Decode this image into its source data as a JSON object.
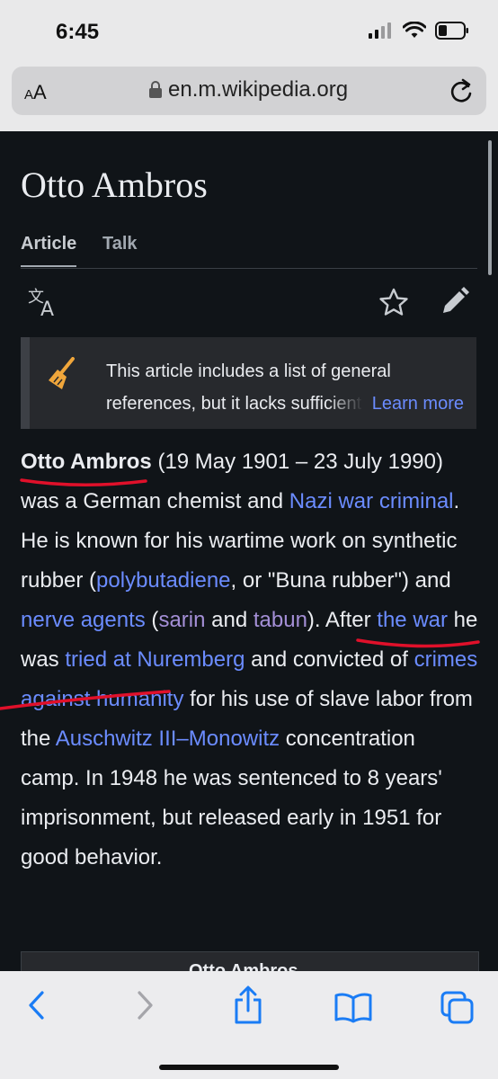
{
  "status": {
    "time": "6:45"
  },
  "urlbar": {
    "text_size": "AA",
    "url": "en.m.wikipedia.org"
  },
  "article": {
    "title": "Otto Ambros",
    "tabs": [
      "Article",
      "Talk"
    ],
    "notice": {
      "line1": "This article includes a list of general",
      "line2": "references, but it lacks sufficient",
      "learn_more": "Learn more"
    },
    "lead": {
      "name": "Otto Ambros",
      "t1": " (19 May 1901 – 23 July 1990) was a German chemist and ",
      "l_nazi": "Nazi war criminal",
      "t2": ". He is known for his wartime work on synthetic rubber (",
      "l_polybutadiene": "polybutadiene",
      "t3": ", or \"Buna rubber\") and ",
      "l_nerve": "nerve agents",
      "t4": " (",
      "l_sarin": "sarin",
      "t5": " and ",
      "l_tabun": "tabun",
      "t6": "). After ",
      "l_war": "the war",
      "t7": " he was ",
      "l_tried": "tried at Nuremberg",
      "t8": " and convicted of ",
      "l_crimes": "crimes against humanity",
      "t9": " for his use of slave labor from the ",
      "l_auschwitz": "Auschwitz III–Monowitz",
      "t10": " concentration camp. In 1948 he was sentenced to 8 years' imprisonment, but released early in 1951 for good behavior."
    },
    "infobox_title": "Otto Ambros"
  },
  "colors": {
    "link": "#6b8cff",
    "visited": "#a48fd6",
    "annotation": "#e0102a",
    "ios_blue": "#1a7cf5"
  },
  "toolbar": {
    "icons": [
      "back-icon",
      "forward-icon",
      "share-icon",
      "bookmarks-icon",
      "tabs-icon"
    ]
  }
}
